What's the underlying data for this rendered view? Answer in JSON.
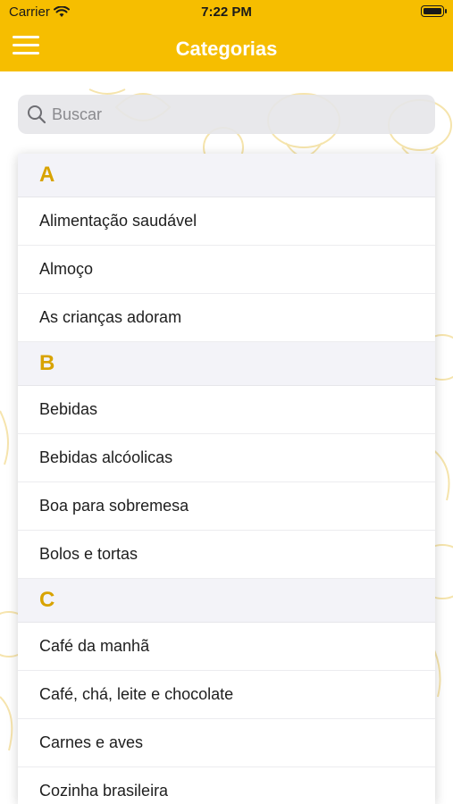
{
  "status": {
    "carrier": "Carrier",
    "time": "7:22 PM"
  },
  "header": {
    "title": "Categorias"
  },
  "search": {
    "placeholder": "Buscar"
  },
  "sections": [
    {
      "letter": "A",
      "items": [
        "Alimentação saudável",
        "Almoço",
        "As crianças adoram"
      ]
    },
    {
      "letter": "B",
      "items": [
        "Bebidas",
        "Bebidas alcóolicas",
        "Boa para sobremesa",
        "Bolos e tortas"
      ]
    },
    {
      "letter": "C",
      "items": [
        "Café da manhã",
        "Café, chá, leite e chocolate",
        "Carnes e aves",
        "Cozinha brasileira"
      ]
    }
  ],
  "colors": {
    "accent": "#F6BE00",
    "section_letter": "#D8A300",
    "section_bg": "#F3F3F8"
  },
  "icons": {
    "menu": "hamburger-menu-icon",
    "search": "search-icon",
    "wifi": "wifi-icon",
    "battery": "battery-icon"
  }
}
